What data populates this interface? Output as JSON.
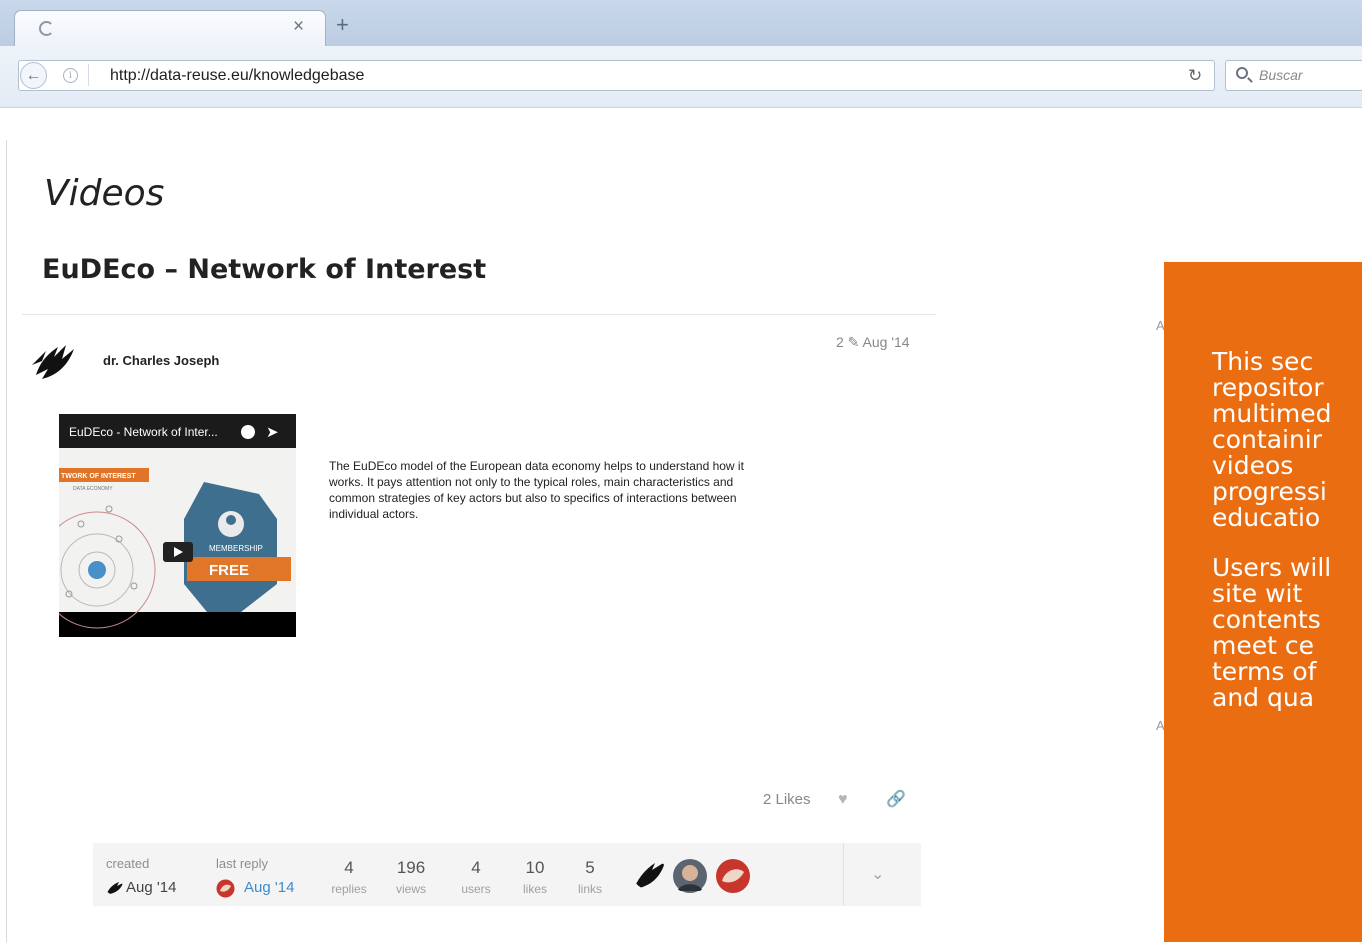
{
  "browser": {
    "url": "http://data-reuse.eu/knowledgebase",
    "search_placeholder": "Buscar",
    "tab_close": "×",
    "new_tab": "+",
    "info": "i"
  },
  "page": {
    "heading": "Videos",
    "topic_title": "EuDEco – Network of Interest"
  },
  "post": {
    "author": "dr. Charles Joseph",
    "meta": "2 ✎ Aug '14",
    "video": {
      "title": "EuDEco - Network of Inter...",
      "banner": "TWORK OF INTEREST",
      "banner_sub": "DATA ECONOMY",
      "badge_top": "MEMBERSHIP",
      "badge_bottom": "FREE"
    },
    "body": "The EuDEco model of the European data economy helps to understand how it works. It pays attention not only to the typical roles, main characteristics and common strategies of key actors but also to specifics of interactions between individual actors.",
    "likes": "2 Likes"
  },
  "stats": {
    "created_label": "created",
    "created_value": "Aug '14",
    "last_reply_label": "last reply",
    "last_reply_value": "Aug '14",
    "items": [
      {
        "num": "4",
        "unit": "replies"
      },
      {
        "num": "196",
        "unit": "views"
      },
      {
        "num": "4",
        "unit": "users"
      },
      {
        "num": "10",
        "unit": "likes"
      },
      {
        "num": "5",
        "unit": "links"
      }
    ]
  },
  "side_panel": {
    "paragraph1_lines": [
      "This   sec",
      "repositor",
      "multimed",
      "containir",
      "videos",
      "progressi",
      "educatio"
    ],
    "paragraph2_lines": [
      "Users will",
      "site   wit",
      "contents",
      "meet  ce",
      "terms of",
      "and qua"
    ]
  },
  "colors": {
    "panel": "#eb6d12",
    "link": "#3b8bd0"
  }
}
